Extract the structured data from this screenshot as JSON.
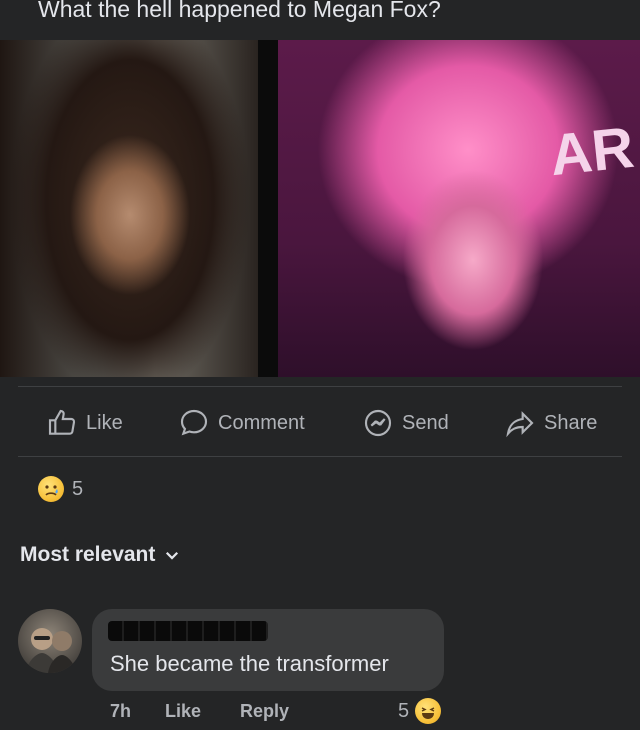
{
  "post": {
    "title": "What the hell happened to Megan Fox?",
    "images": [
      {
        "name": "left-photo",
        "description": ""
      },
      {
        "name": "right-photo",
        "sign_text": "AR"
      }
    ]
  },
  "actions": {
    "like_label": "Like",
    "comment_label": "Comment",
    "send_label": "Send",
    "share_label": "Share"
  },
  "reactions": {
    "count": "5",
    "type": "sad"
  },
  "comments_section": {
    "sort_label": "Most relevant"
  },
  "comment": {
    "author_redacted": true,
    "text": "She became the transformer",
    "time": "7h",
    "like_label": "Like",
    "reply_label": "Reply",
    "reaction_count": "5",
    "reaction_type": "laugh"
  },
  "colors": {
    "background": "#242526",
    "bubble": "#3a3b3c",
    "primary_text": "#e4e6eb",
    "secondary_text": "#b0b3b8"
  }
}
